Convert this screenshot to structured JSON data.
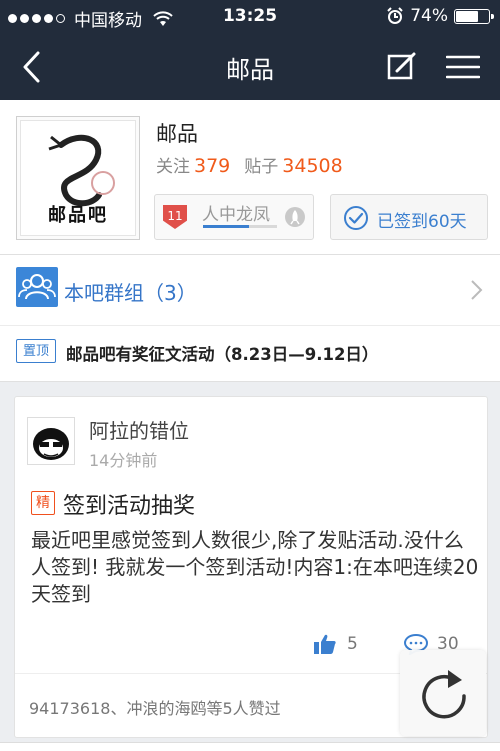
{
  "status_bar": {
    "carrier": "中国移动",
    "time": "13:25",
    "battery_percent": "74%",
    "battery_level": 0.74
  },
  "nav": {
    "title": "邮品"
  },
  "forum": {
    "logo_text": "邮品吧",
    "name": "邮品",
    "follow_label": "关注",
    "follow_count": "379",
    "posts_label": "贴子",
    "posts_count": "34508",
    "level_badge": "11",
    "level_title": "人中龙凤",
    "level_progress": 0.62,
    "signin_label": "已签到60天"
  },
  "group": {
    "label": "本吧群组（3）"
  },
  "sticky": {
    "tag": "置顶",
    "title": "邮品吧有奖征文活动（8.23日—9.12日）"
  },
  "post": {
    "author": "阿拉的错位",
    "time": "14分钟前",
    "badge": "精",
    "title": "签到活动抽奖",
    "body": "最近吧里感觉签到人数很少,除了发贴活动.没什么人签到! 我就发一个签到活动!内容1:在本吧连续20天签到",
    "likes": "5",
    "comments": "30",
    "likers_text": "94173618、冲浪的海鸥等5人赞过"
  },
  "colors": {
    "navbar": "#222c3b",
    "accent_blue": "#3b7fcf",
    "accent_orange": "#f05a1a",
    "background": "#eceef1"
  }
}
